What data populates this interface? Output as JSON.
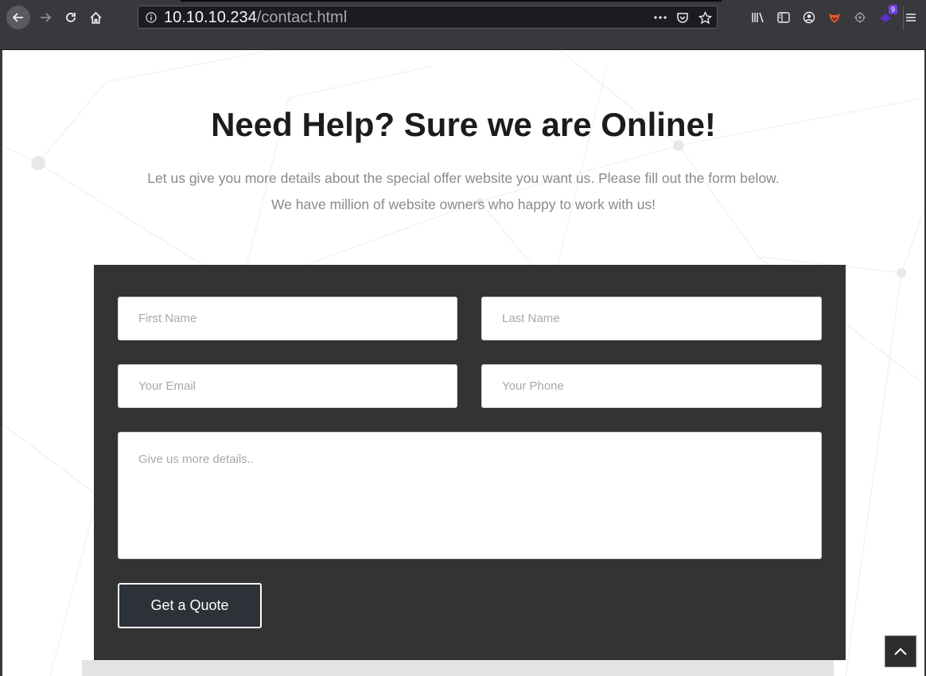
{
  "browser": {
    "url_host": "10.10.10.234",
    "url_path": "/contact.html",
    "extension_badge": "9"
  },
  "page": {
    "heading": "Need Help? Sure we are Online!",
    "subtitle_line1": "Let us give you more details about the special offer website you want us. Please fill out the form below.",
    "subtitle_line2": "We have million of website owners who happy to work with us!"
  },
  "form": {
    "first_name_placeholder": "First Name",
    "last_name_placeholder": "Last Name",
    "email_placeholder": "Your Email",
    "phone_placeholder": "Your Phone",
    "details_placeholder": "Give us more details..",
    "submit_label": "Get a Quote"
  },
  "colors": {
    "chrome": "#38383d",
    "form_bg": "#333333",
    "button_bg": "#2c3238"
  },
  "icons": {
    "scroll_top": "chevron-up-icon"
  }
}
